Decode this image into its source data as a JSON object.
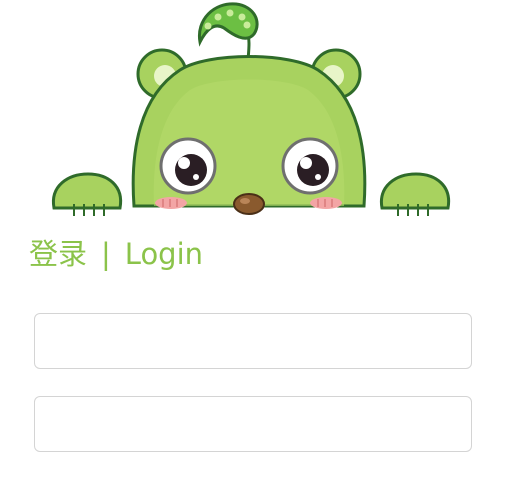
{
  "login": {
    "title_cn": "登录",
    "separator": "|",
    "title_en": "Login",
    "username": {
      "value": "",
      "placeholder": ""
    },
    "password": {
      "value": "",
      "placeholder": ""
    }
  },
  "mascot": {
    "icon": "green-bean-mascot-icon",
    "body_color": "#a8d25f",
    "outline_color": "#2f6b2a"
  },
  "theme": {
    "accent": "#8bc34a",
    "field_border": "#d4d4d4"
  }
}
